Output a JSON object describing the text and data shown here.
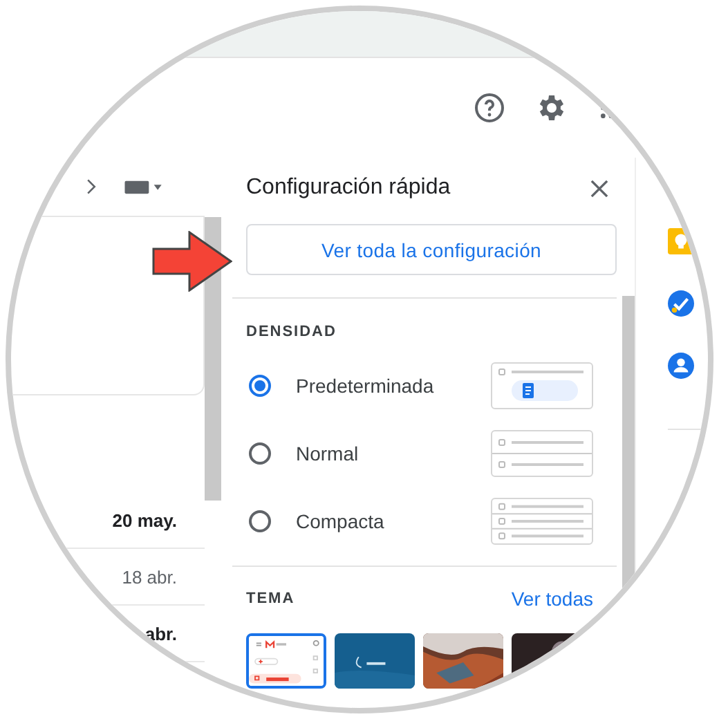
{
  "mail_dates": [
    {
      "text": "20 may.",
      "unread": true
    },
    {
      "text": "18 abr.",
      "unread": false
    },
    {
      "text": "abr.",
      "unread": true
    }
  ],
  "quick_settings": {
    "title": "Configuración rápida",
    "all_settings_button": "Ver toda la configuración",
    "density": {
      "heading": "DENSIDAD",
      "options": [
        {
          "label": "Predeterminada",
          "selected": true,
          "kind": "default"
        },
        {
          "label": "Normal",
          "selected": false,
          "kind": "comfortable"
        },
        {
          "label": "Compacta",
          "selected": false,
          "kind": "compact"
        }
      ]
    },
    "theme": {
      "heading": "TEMA",
      "link": "Ver todas",
      "thumbnails": [
        {
          "kind": "preview",
          "selected": true
        },
        {
          "kind": "picture",
          "selected": false
        },
        {
          "kind": "picture",
          "selected": false
        },
        {
          "kind": "picture",
          "selected": false
        }
      ]
    }
  }
}
